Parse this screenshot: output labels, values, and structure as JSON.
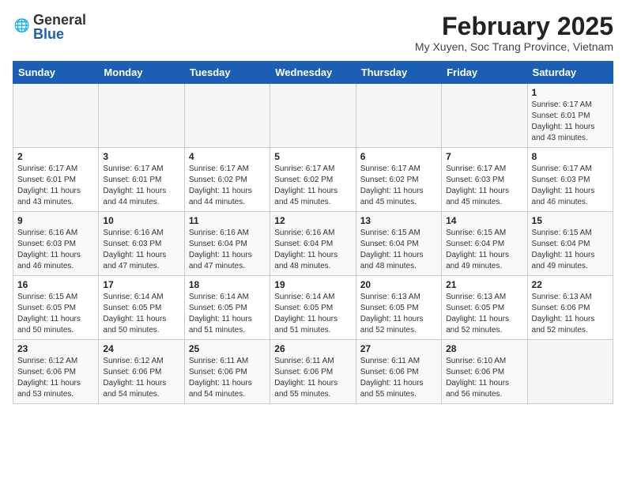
{
  "logo": {
    "general": "General",
    "blue": "Blue"
  },
  "header": {
    "month": "February 2025",
    "location": "My Xuyen, Soc Trang Province, Vietnam"
  },
  "weekdays": [
    "Sunday",
    "Monday",
    "Tuesday",
    "Wednesday",
    "Thursday",
    "Friday",
    "Saturday"
  ],
  "weeks": [
    [
      {
        "day": "",
        "info": ""
      },
      {
        "day": "",
        "info": ""
      },
      {
        "day": "",
        "info": ""
      },
      {
        "day": "",
        "info": ""
      },
      {
        "day": "",
        "info": ""
      },
      {
        "day": "",
        "info": ""
      },
      {
        "day": "1",
        "info": "Sunrise: 6:17 AM\nSunset: 6:01 PM\nDaylight: 11 hours\nand 43 minutes."
      }
    ],
    [
      {
        "day": "2",
        "info": "Sunrise: 6:17 AM\nSunset: 6:01 PM\nDaylight: 11 hours\nand 43 minutes."
      },
      {
        "day": "3",
        "info": "Sunrise: 6:17 AM\nSunset: 6:01 PM\nDaylight: 11 hours\nand 44 minutes."
      },
      {
        "day": "4",
        "info": "Sunrise: 6:17 AM\nSunset: 6:02 PM\nDaylight: 11 hours\nand 44 minutes."
      },
      {
        "day": "5",
        "info": "Sunrise: 6:17 AM\nSunset: 6:02 PM\nDaylight: 11 hours\nand 45 minutes."
      },
      {
        "day": "6",
        "info": "Sunrise: 6:17 AM\nSunset: 6:02 PM\nDaylight: 11 hours\nand 45 minutes."
      },
      {
        "day": "7",
        "info": "Sunrise: 6:17 AM\nSunset: 6:03 PM\nDaylight: 11 hours\nand 45 minutes."
      },
      {
        "day": "8",
        "info": "Sunrise: 6:17 AM\nSunset: 6:03 PM\nDaylight: 11 hours\nand 46 minutes."
      }
    ],
    [
      {
        "day": "9",
        "info": "Sunrise: 6:16 AM\nSunset: 6:03 PM\nDaylight: 11 hours\nand 46 minutes."
      },
      {
        "day": "10",
        "info": "Sunrise: 6:16 AM\nSunset: 6:03 PM\nDaylight: 11 hours\nand 47 minutes."
      },
      {
        "day": "11",
        "info": "Sunrise: 6:16 AM\nSunset: 6:04 PM\nDaylight: 11 hours\nand 47 minutes."
      },
      {
        "day": "12",
        "info": "Sunrise: 6:16 AM\nSunset: 6:04 PM\nDaylight: 11 hours\nand 48 minutes."
      },
      {
        "day": "13",
        "info": "Sunrise: 6:15 AM\nSunset: 6:04 PM\nDaylight: 11 hours\nand 48 minutes."
      },
      {
        "day": "14",
        "info": "Sunrise: 6:15 AM\nSunset: 6:04 PM\nDaylight: 11 hours\nand 49 minutes."
      },
      {
        "day": "15",
        "info": "Sunrise: 6:15 AM\nSunset: 6:04 PM\nDaylight: 11 hours\nand 49 minutes."
      }
    ],
    [
      {
        "day": "16",
        "info": "Sunrise: 6:15 AM\nSunset: 6:05 PM\nDaylight: 11 hours\nand 50 minutes."
      },
      {
        "day": "17",
        "info": "Sunrise: 6:14 AM\nSunset: 6:05 PM\nDaylight: 11 hours\nand 50 minutes."
      },
      {
        "day": "18",
        "info": "Sunrise: 6:14 AM\nSunset: 6:05 PM\nDaylight: 11 hours\nand 51 minutes."
      },
      {
        "day": "19",
        "info": "Sunrise: 6:14 AM\nSunset: 6:05 PM\nDaylight: 11 hours\nand 51 minutes."
      },
      {
        "day": "20",
        "info": "Sunrise: 6:13 AM\nSunset: 6:05 PM\nDaylight: 11 hours\nand 52 minutes."
      },
      {
        "day": "21",
        "info": "Sunrise: 6:13 AM\nSunset: 6:05 PM\nDaylight: 11 hours\nand 52 minutes."
      },
      {
        "day": "22",
        "info": "Sunrise: 6:13 AM\nSunset: 6:06 PM\nDaylight: 11 hours\nand 52 minutes."
      }
    ],
    [
      {
        "day": "23",
        "info": "Sunrise: 6:12 AM\nSunset: 6:06 PM\nDaylight: 11 hours\nand 53 minutes."
      },
      {
        "day": "24",
        "info": "Sunrise: 6:12 AM\nSunset: 6:06 PM\nDaylight: 11 hours\nand 54 minutes."
      },
      {
        "day": "25",
        "info": "Sunrise: 6:11 AM\nSunset: 6:06 PM\nDaylight: 11 hours\nand 54 minutes."
      },
      {
        "day": "26",
        "info": "Sunrise: 6:11 AM\nSunset: 6:06 PM\nDaylight: 11 hours\nand 55 minutes."
      },
      {
        "day": "27",
        "info": "Sunrise: 6:11 AM\nSunset: 6:06 PM\nDaylight: 11 hours\nand 55 minutes."
      },
      {
        "day": "28",
        "info": "Sunrise: 6:10 AM\nSunset: 6:06 PM\nDaylight: 11 hours\nand 56 minutes."
      },
      {
        "day": "",
        "info": ""
      }
    ]
  ]
}
